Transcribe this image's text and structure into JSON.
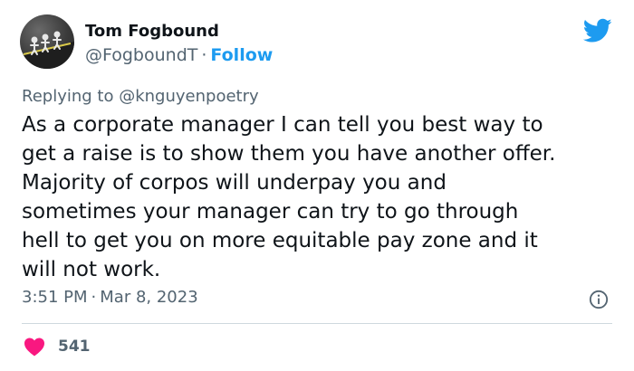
{
  "author": {
    "name": "Tom Fogbound",
    "handle": "@FogboundT",
    "separator": "·",
    "follow_label": "Follow"
  },
  "reply": {
    "prefix": "Replying to",
    "mention": "@knguyenpoetry"
  },
  "tweet": {
    "text": "As a corporate manager I can tell you best way to\nget a raise is to show them you have another offer.\nMajority of corpos will underpay you and\nsometimes your manager can try to go through\nhell to get you on more equitable pay zone and it\nwill not work."
  },
  "meta": {
    "time": "3:51 PM",
    "separator": "·",
    "date": "Mar 8, 2023"
  },
  "stats": {
    "likes": "541"
  },
  "icons": {
    "logo": "twitter-bird-icon",
    "info": "info-icon",
    "like": "heart-icon"
  },
  "colors": {
    "accent": "#1d9bf0",
    "heart": "#f91880",
    "secondary_text": "#536471",
    "primary_text": "#0f1419",
    "divider": "#cfd9de"
  }
}
